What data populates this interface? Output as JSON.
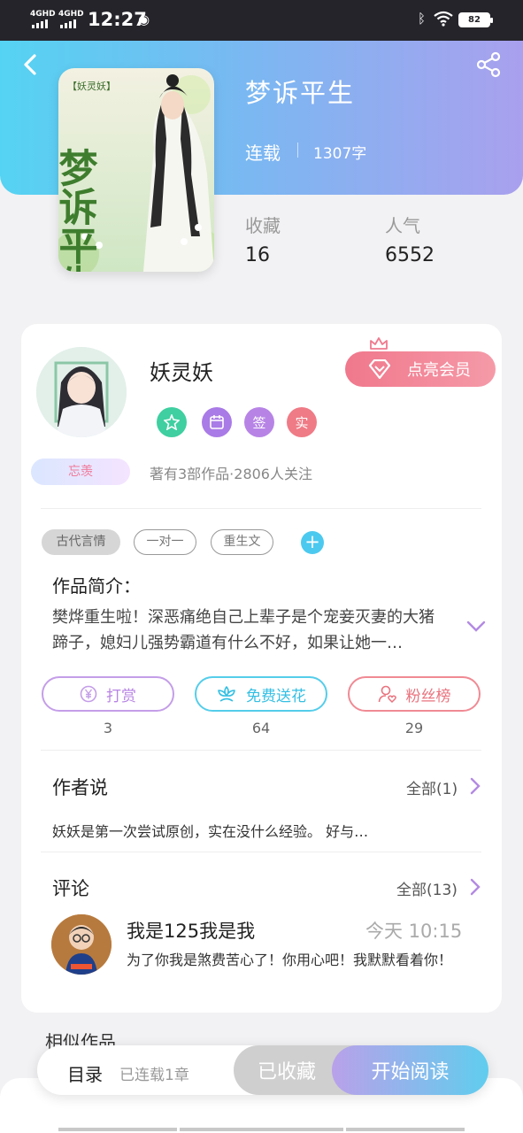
{
  "status_bar": {
    "signal_1": "4GHD",
    "signal_2": "4GHD",
    "time": "12:27",
    "battery": "82"
  },
  "book": {
    "title": "梦诉平生",
    "status": "连载",
    "word_count": "1307字",
    "cover_label": "【妖灵妖】",
    "cover_title": "梦诉平生",
    "stats": [
      {
        "label": "收藏",
        "value": "16"
      },
      {
        "label": "人气",
        "value": "6552"
      }
    ]
  },
  "author": {
    "name": "妖灵妖",
    "vip_button": "点亮会员",
    "nickname_tag": "忘羡",
    "badges": [
      {
        "icon": "medal-icon",
        "text": "",
        "color": "#3fcfa0"
      },
      {
        "icon": "calendar-icon",
        "text": "",
        "color": "#a97be6"
      },
      {
        "icon": "sign-icon",
        "text": "签",
        "color": "#b784e6"
      },
      {
        "icon": "real-name-icon",
        "text": "实",
        "color": "#ef7b86"
      }
    ],
    "summary": "著有3部作品·2806人关注"
  },
  "tags": [
    "古代言情",
    "一对一",
    "重生文"
  ],
  "intro": {
    "heading": "作品简介：",
    "text": "樊烨重生啦！深恶痛绝自己上辈子是个宠妾灭妻的大猪蹄子，媳妇儿强势霸道有什么不好，如果让她一…"
  },
  "actions": [
    {
      "label": "打赏",
      "count": "3"
    },
    {
      "label": "免费送花",
      "count": "64"
    },
    {
      "label": "粉丝榜",
      "count": "29"
    }
  ],
  "author_says": {
    "title": "作者说",
    "link": "全部(1)",
    "text": "妖妖是第一次尝试原创，实在没什么经验。 好与…"
  },
  "comments": {
    "title": "评论",
    "link": "全部(13)",
    "items": [
      {
        "user": "我是125我是我",
        "time": "今天 10:15",
        "text": "为了你我是煞费苦心了！你用心吧！我默默看着你！"
      }
    ]
  },
  "similar_title": "相似作品",
  "bottom_bar": {
    "toc": "目录",
    "chapters": "已连载1章",
    "favorited": "已收藏",
    "start_reading": "开始阅读"
  },
  "colors": {
    "header_start": "#55d3f2",
    "header_end": "#a9a0ee",
    "vip": "#f0788c",
    "read_button_start": "#b9a1ea",
    "read_button_end": "#60cdee"
  }
}
